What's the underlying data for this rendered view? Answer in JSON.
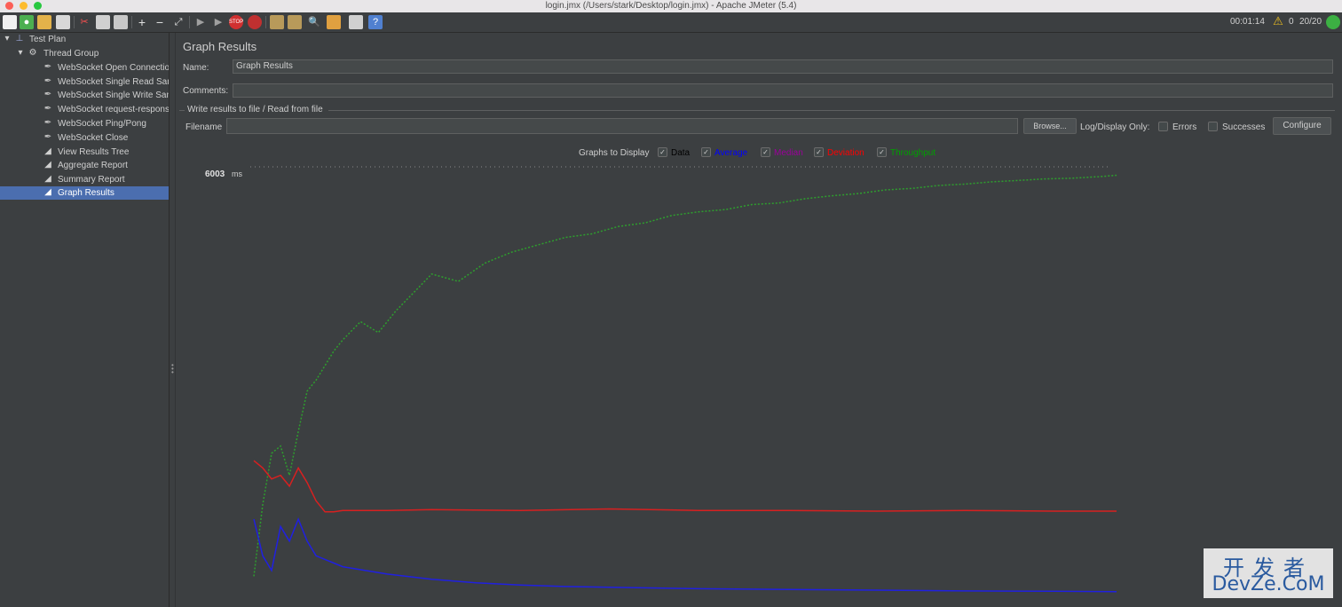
{
  "window": {
    "title": "login.jmx (/Users/stark/Desktop/login.jmx) - Apache JMeter (5.4)"
  },
  "status": {
    "elapsed": "00:01:14",
    "warnings": "0",
    "threads": "20/20"
  },
  "tree": {
    "items": [
      {
        "label": "Test Plan",
        "icon": "test-plan-icon"
      },
      {
        "label": "Thread Group",
        "icon": "gear-icon"
      },
      {
        "label": "WebSocket Open Connection",
        "icon": "pipette-icon"
      },
      {
        "label": "WebSocket Single Read Sampler",
        "icon": "pipette-icon"
      },
      {
        "label": "WebSocket Single Write Sampler",
        "icon": "pipette-icon"
      },
      {
        "label": "WebSocket request-response Sampler",
        "icon": "pipette-icon"
      },
      {
        "label": "WebSocket Ping/Pong",
        "icon": "pipette-icon"
      },
      {
        "label": "WebSocket Close",
        "icon": "pipette-icon"
      },
      {
        "label": "View Results Tree",
        "icon": "chart-icon"
      },
      {
        "label": "Aggregate Report",
        "icon": "chart-icon"
      },
      {
        "label": "Summary Report",
        "icon": "chart-icon"
      },
      {
        "label": "Graph Results",
        "icon": "chart-icon",
        "selected": true
      }
    ]
  },
  "panel": {
    "title": "Graph Results",
    "name_label": "Name:",
    "name_value": "Graph Results",
    "comments_label": "Comments:",
    "comments_value": "",
    "file_group_title": "Write results to file / Read from file",
    "filename_label": "Filename",
    "filename_value": "",
    "browse_label": "Browse...",
    "log_display_label": "Log/Display Only:",
    "errors_label": "Errors",
    "successes_label": "Successes",
    "configure_label": "Configure"
  },
  "graphs_to_display": {
    "label": "Graphs to Display",
    "options": [
      {
        "label": "Data",
        "color": "#000000",
        "checked": true
      },
      {
        "label": "Average",
        "color": "#0000ff",
        "checked": true
      },
      {
        "label": "Median",
        "color": "#9b009b",
        "checked": true
      },
      {
        "label": "Deviation",
        "color": "#ff0000",
        "checked": true
      },
      {
        "label": "Throughput",
        "color": "#00a000",
        "checked": true
      }
    ]
  },
  "chart_data": {
    "type": "line",
    "y_max_label": "6003",
    "y_unit": "ms",
    "y_max": 6003,
    "grid": false,
    "series": [
      {
        "name": "Throughput",
        "color": "#2e9e2e",
        "x": [
          0,
          10,
          20,
          30,
          40,
          50,
          60,
          70,
          80,
          90,
          100,
          120,
          140,
          160,
          180,
          200,
          230,
          260,
          290,
          320,
          350,
          380,
          410,
          440,
          470,
          500,
          530,
          560,
          590,
          620,
          650,
          680,
          710,
          740,
          770,
          800,
          830,
          860,
          890,
          920,
          950,
          970
        ],
        "y": [
          420,
          1400,
          2100,
          2200,
          1800,
          2400,
          2950,
          3100,
          3300,
          3500,
          3650,
          3900,
          3750,
          4050,
          4300,
          4550,
          4450,
          4700,
          4850,
          4950,
          5050,
          5100,
          5200,
          5250,
          5350,
          5400,
          5430,
          5500,
          5520,
          5580,
          5620,
          5650,
          5700,
          5720,
          5760,
          5780,
          5810,
          5830,
          5850,
          5860,
          5880,
          5900
        ]
      },
      {
        "name": "Deviation",
        "color": "#d82020",
        "x": [
          0,
          10,
          20,
          30,
          40,
          50,
          60,
          70,
          80,
          90,
          100,
          150,
          200,
          300,
          400,
          500,
          600,
          700,
          800,
          900,
          970
        ],
        "y": [
          2000,
          1900,
          1750,
          1800,
          1650,
          1900,
          1700,
          1450,
          1300,
          1300,
          1320,
          1320,
          1330,
          1320,
          1340,
          1320,
          1320,
          1310,
          1320,
          1310,
          1310
        ]
      },
      {
        "name": "Average",
        "color": "#2020e0",
        "x": [
          0,
          10,
          20,
          30,
          40,
          50,
          60,
          70,
          80,
          90,
          100,
          150,
          200,
          250,
          300,
          350,
          400,
          500,
          600,
          700,
          800,
          900,
          970
        ],
        "y": [
          1200,
          700,
          500,
          1100,
          900,
          1200,
          900,
          700,
          650,
          600,
          550,
          450,
          380,
          330,
          300,
          280,
          270,
          250,
          240,
          230,
          220,
          215,
          210
        ]
      }
    ]
  }
}
